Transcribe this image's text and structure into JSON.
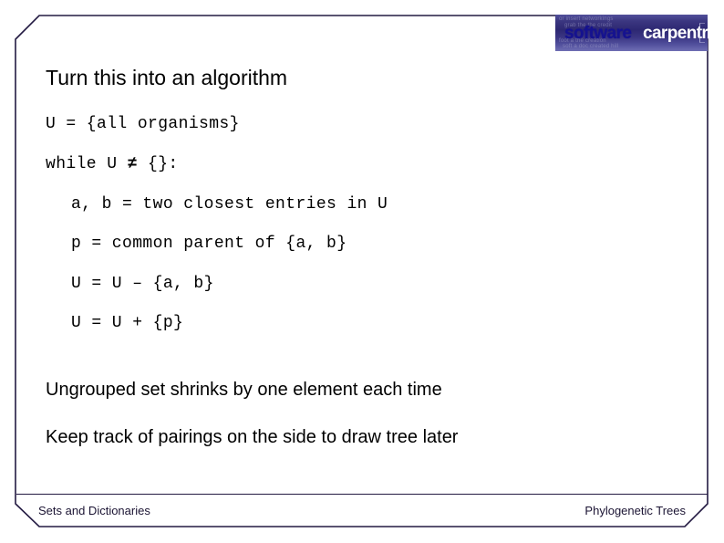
{
  "slide": {
    "title": "Turn this into an algorithm",
    "logo": {
      "word_one": "software",
      "word_two": "carpentry",
      "ghost_line_1": "or insert networkings",
      "ghost_line_2": "grab the the credit",
      "ghost_line_3": "foot a the creation",
      "ghost_line_4": "soft a doc created hill",
      "bg_color_dark": "#2d2872",
      "bg_color_light": "#6f6eb4",
      "word_one_color": "#15128f",
      "word_two_color": "#ffffff"
    },
    "code_lines": [
      {
        "text": "U = {all organisms}",
        "indent": 0
      },
      {
        "text": "while U ≠ {}:",
        "indent": 0
      },
      {
        "text": "a, b = two closest entries in U",
        "indent": 1
      },
      {
        "text": "p = common parent of {a, b}",
        "indent": 1
      },
      {
        "text": "U = U – {a, b}",
        "indent": 1
      },
      {
        "text": "U = U + {p}",
        "indent": 1
      }
    ],
    "body_lines": [
      "Ungrouped set shrinks by one element each time",
      "Keep track of pairings on the side to draw tree later"
    ],
    "footer": {
      "left": "Sets and Dictionaries",
      "right": "Phylogenetic Trees"
    },
    "border_color": "#231a42"
  }
}
